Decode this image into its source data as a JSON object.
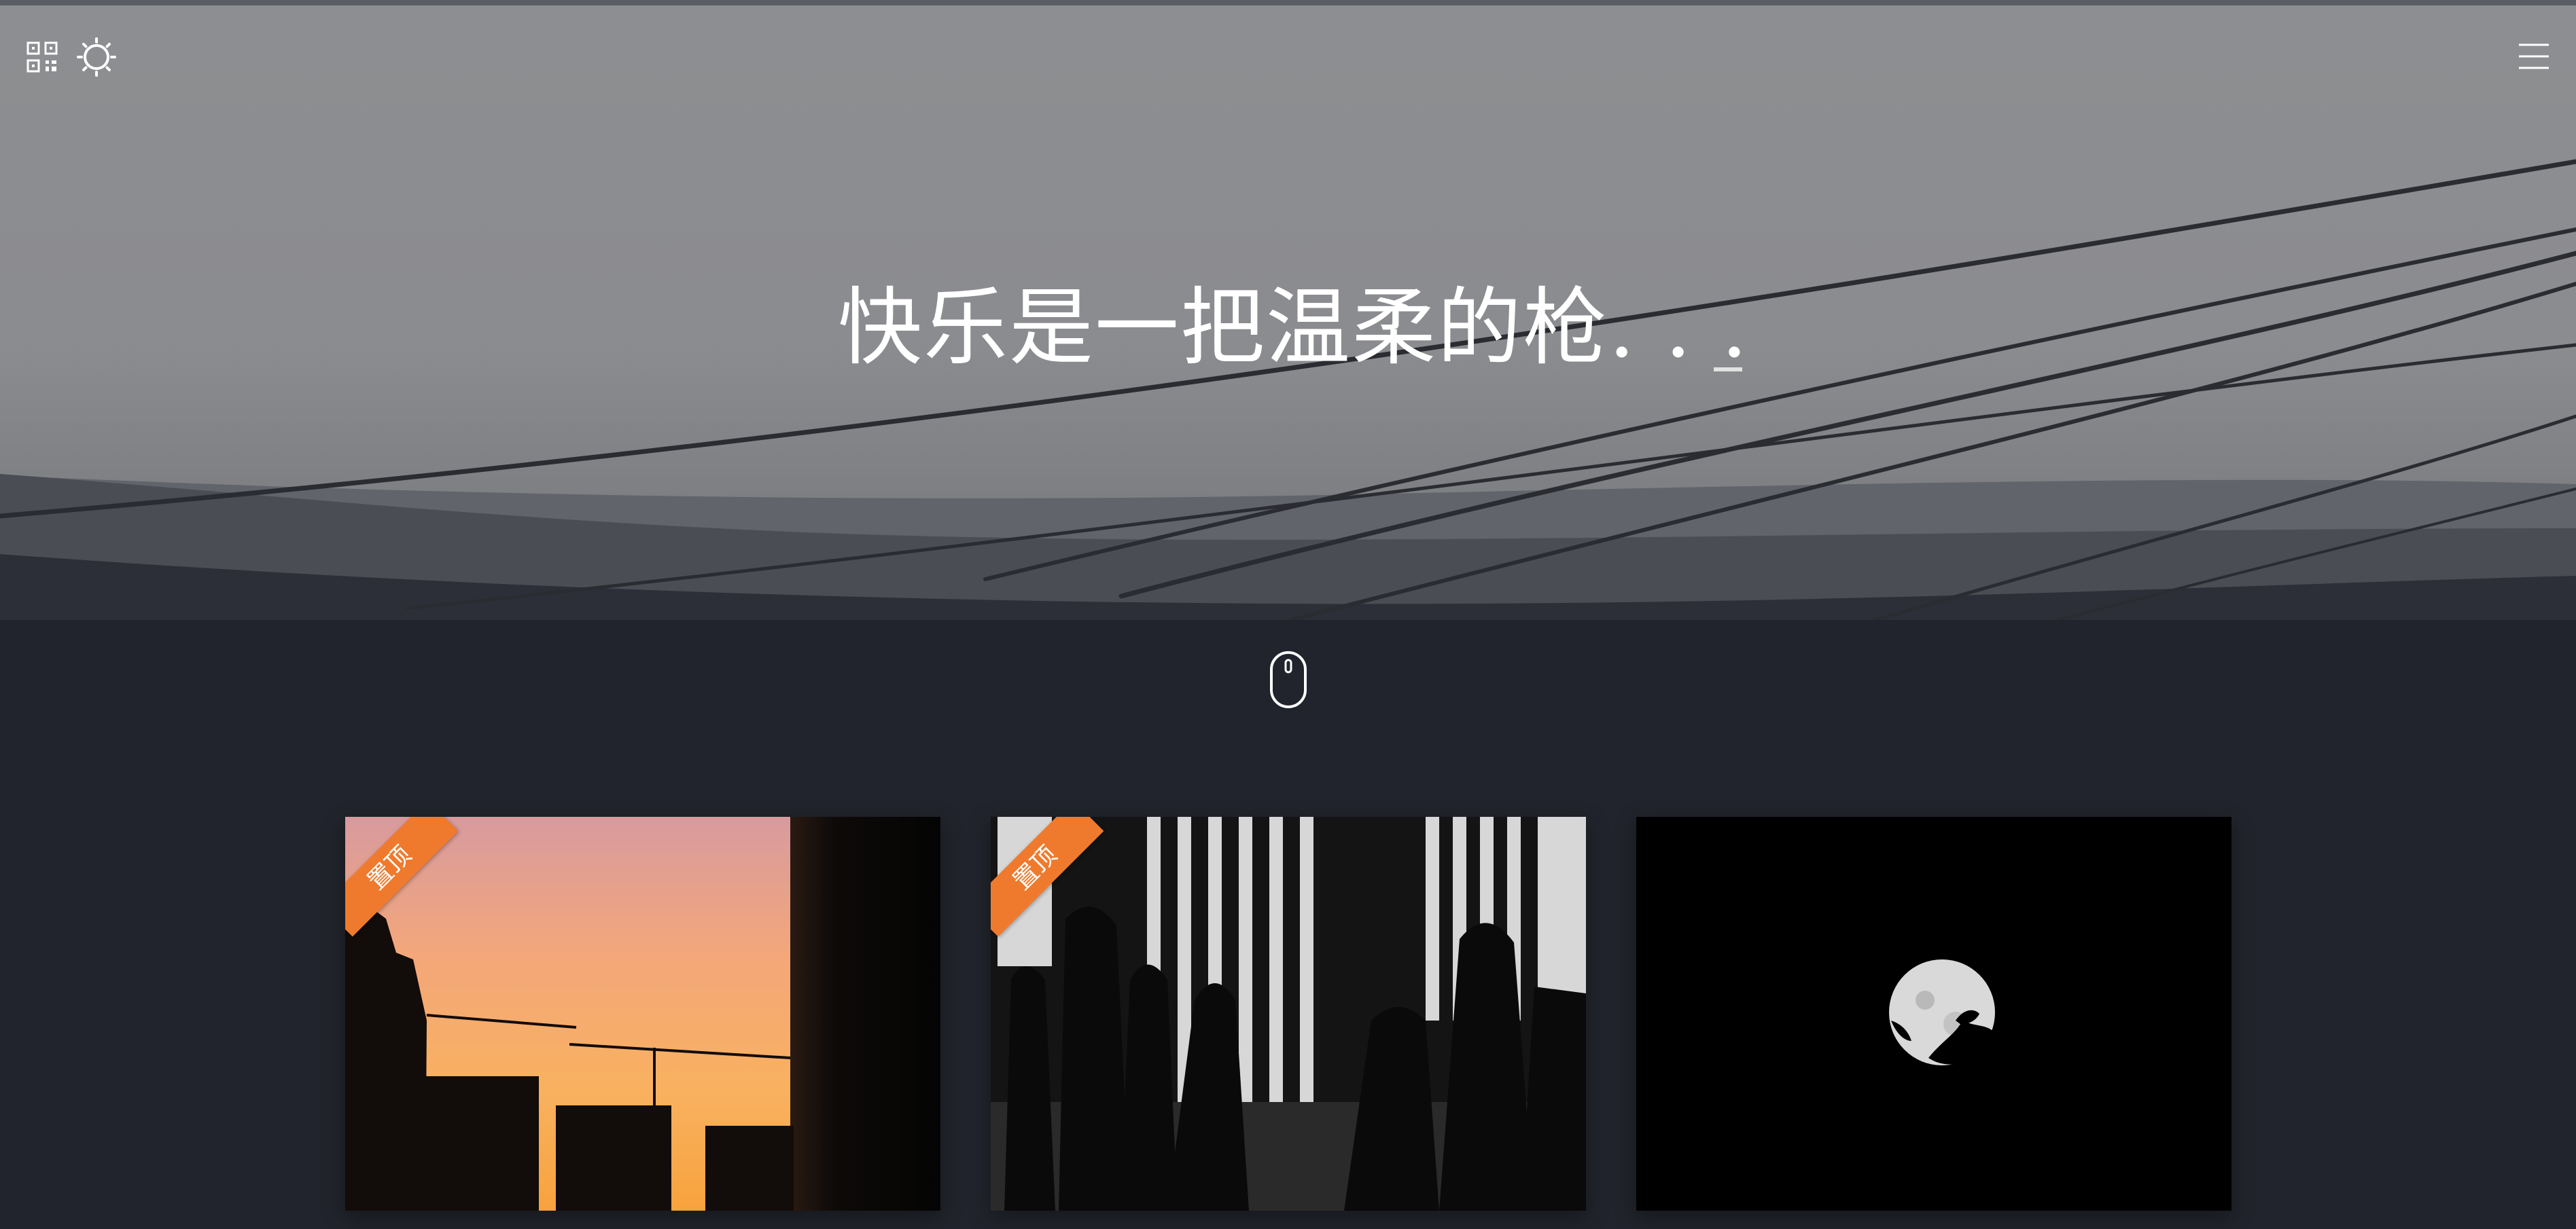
{
  "header": {
    "headline": "快乐是一把温柔的枪. . .",
    "icons": [
      "qr-code-icon",
      "theme-toggle-icon",
      "menu-icon"
    ]
  },
  "scroll_hint": {
    "icon": "mouse-scroll-icon"
  },
  "posts": [
    {
      "badge": "置顶",
      "image": "sunset-construction-cranes-silhouette"
    },
    {
      "badge": "置顶",
      "image": "people-silhouette-by-window-sea"
    },
    {
      "badge": "",
      "image": "moon-with-tree-silhouette"
    }
  ],
  "colors": {
    "page_background": "#21242c",
    "hero_sky": "#8b8c8f",
    "badge": "#ef7a2d",
    "text": "#ffffff"
  }
}
